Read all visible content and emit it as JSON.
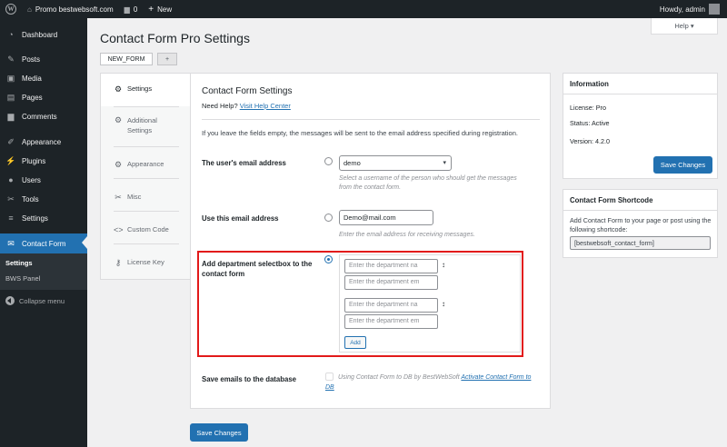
{
  "admin_bar": {
    "site_name": "Promo bestwebsoft.com",
    "comments_count": "0",
    "new_label": "New",
    "greeting": "Howdy, admin"
  },
  "sidebar": {
    "items": [
      {
        "label": "Dashboard",
        "icon": "dashboard-icon"
      },
      {
        "label": "Posts",
        "icon": "pin-icon"
      },
      {
        "label": "Media",
        "icon": "media-icon"
      },
      {
        "label": "Pages",
        "icon": "page-icon"
      },
      {
        "label": "Comments",
        "icon": "comment-icon"
      },
      {
        "label": "Appearance",
        "icon": "brush-icon"
      },
      {
        "label": "Plugins",
        "icon": "plug-icon"
      },
      {
        "label": "Users",
        "icon": "user-icon"
      },
      {
        "label": "Tools",
        "icon": "wrench-icon"
      },
      {
        "label": "Settings",
        "icon": "sliders-icon"
      },
      {
        "label": "Contact Form",
        "icon": "envelope-icon"
      }
    ],
    "submenu": [
      "Settings",
      "BWS Panel"
    ],
    "collapse_label": "Collapse menu"
  },
  "help_label": "Help ▾",
  "page_title": "Contact Form Pro Settings",
  "form_tabs": {
    "active": "NEW_FORM",
    "add": "+"
  },
  "vertical_tabs": [
    {
      "label": "Settings",
      "icon": "gear-icon"
    },
    {
      "label": "Additional Settings",
      "icon": "gear-icon"
    },
    {
      "label": "Appearance",
      "icon": "gear-icon"
    },
    {
      "label": "Misc",
      "icon": "wrench-icon"
    },
    {
      "label": "Custom Code",
      "icon": "code-icon"
    },
    {
      "label": "License Key",
      "icon": "key-icon"
    }
  ],
  "panel": {
    "title": "Contact Form Settings",
    "help_prefix": "Need Help?",
    "help_link": "Visit Help Center",
    "intro": "If you leave the fields empty, the messages will be sent to the email address specified during registration.",
    "user_email": {
      "label": "The user's email address",
      "selected": "demo",
      "description": "Select a username of the person who should get the messages from the contact form."
    },
    "custom_email": {
      "label": "Use this email address",
      "value": "Demo@mail.com",
      "description": "Enter the email address for receiving messages."
    },
    "department": {
      "label": "Add department selectbox to the contact form",
      "placeholder": "Enter the department na",
      "placeholder2": "Enter the department em",
      "add_button": "Add"
    },
    "save_db": {
      "label": "Save emails to the database",
      "description_prefix": "Using Contact Form to DB by BestWebSoft",
      "link": "Activate Contact Form to DB"
    },
    "save_button": "Save Changes"
  },
  "info_box": {
    "title": "Information",
    "license": "License: Pro",
    "status": "Status: Active",
    "version": "Version: 4.2.0",
    "save_button": "Save Changes"
  },
  "shortcode_box": {
    "title": "Contact Form Shortcode",
    "text": "Add Contact Form to your page or post using the following shortcode:",
    "shortcode": "[bestwebsoft_contact_form]"
  },
  "colors": {
    "accent": "#2271b1",
    "admin_dark": "#1d2327",
    "highlight_border": "#e21a1a"
  }
}
